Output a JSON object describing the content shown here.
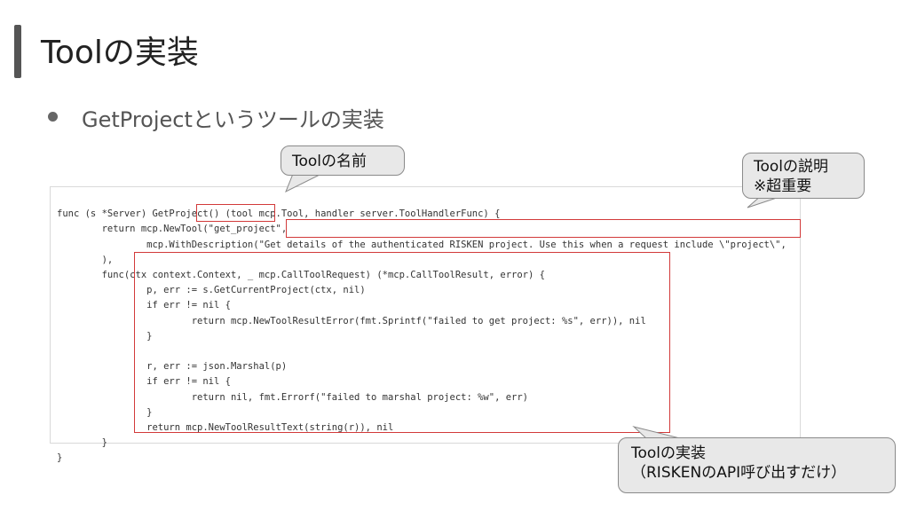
{
  "slide": {
    "title": "Toolの実装",
    "bullet": "GetProjectというツールの実装"
  },
  "code": {
    "lines": [
      "func (s *Server) GetProject() (tool mcp.Tool, handler server.ToolHandlerFunc) {",
      "        return mcp.NewTool(\"get_project\",",
      "                mcp.WithDescription(\"Get details of the authenticated RISKEN project. Use this when a request include \\\"project\\\",",
      "        ),",
      "        func(ctx context.Context, _ mcp.CallToolRequest) (*mcp.CallToolResult, error) {",
      "                p, err := s.GetCurrentProject(ctx, nil)",
      "                if err != nil {",
      "                        return mcp.NewToolResultError(fmt.Sprintf(\"failed to get project: %s\", err)), nil",
      "                }",
      "",
      "                r, err := json.Marshal(p)",
      "                if err != nil {",
      "                        return nil, fmt.Errorf(\"failed to marshal project: %w\", err)",
      "                }",
      "                return mcp.NewToolResultText(string(r)), nil",
      "        }",
      "}"
    ]
  },
  "callouts": {
    "name": "Toolの名前",
    "description_line1": "Toolの説明",
    "description_line2": "※超重要",
    "impl_line1": "Toolの実装",
    "impl_line2": "（RISKENのAPI呼び出すだけ）"
  },
  "colors": {
    "highlight": "#d23a3a",
    "callout_bg": "#e8e8e8",
    "keyword": "#a12a6a",
    "function": "#1f4e9c"
  }
}
